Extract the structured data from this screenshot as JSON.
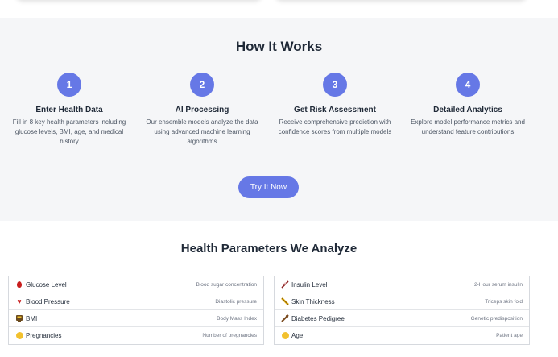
{
  "how_it_works": {
    "title": "How It Works",
    "steps": [
      {
        "number": "1",
        "title": "Enter Health Data",
        "description": "Fill in 8 key health parameters including glucose levels, BMI, age, and medical history"
      },
      {
        "number": "2",
        "title": "AI Processing",
        "description": "Our ensemble models analyze the data using advanced machine learning algorithms"
      },
      {
        "number": "3",
        "title": "Get Risk Assessment",
        "description": "Receive comprehensive prediction with confidence scores from multiple models"
      },
      {
        "number": "4",
        "title": "Detailed Analytics",
        "description": "Explore model performance metrics and understand feature contributions"
      }
    ],
    "cta_label": "Try It Now"
  },
  "parameters": {
    "title": "Health Parameters We Analyze",
    "left": [
      {
        "icon": "blood-drop-icon",
        "name": "Glucose Level",
        "description": "Blood sugar concentration"
      },
      {
        "icon": "heart-icon",
        "name": "Blood Pressure",
        "description": "Diastolic pressure"
      },
      {
        "icon": "scale-icon",
        "name": "BMI",
        "description": "Body Mass Index"
      },
      {
        "icon": "pregnancy-face-icon",
        "name": "Pregnancies",
        "description": "Number of pregnancies"
      }
    ],
    "right": [
      {
        "icon": "syringe-icon",
        "name": "Insulin Level",
        "description": "2-Hour serum insulin"
      },
      {
        "icon": "ruler-icon",
        "name": "Skin Thickness",
        "description": "Triceps skin fold"
      },
      {
        "icon": "dna-icon",
        "name": "Diabetes Pedigree",
        "description": "Genetic predisposition"
      },
      {
        "icon": "age-face-icon",
        "name": "Age",
        "description": "Patient age"
      }
    ]
  },
  "colors": {
    "accent": "#6678e6",
    "section_bg": "#f5f6f8",
    "drop_red": "#c81e1e"
  }
}
